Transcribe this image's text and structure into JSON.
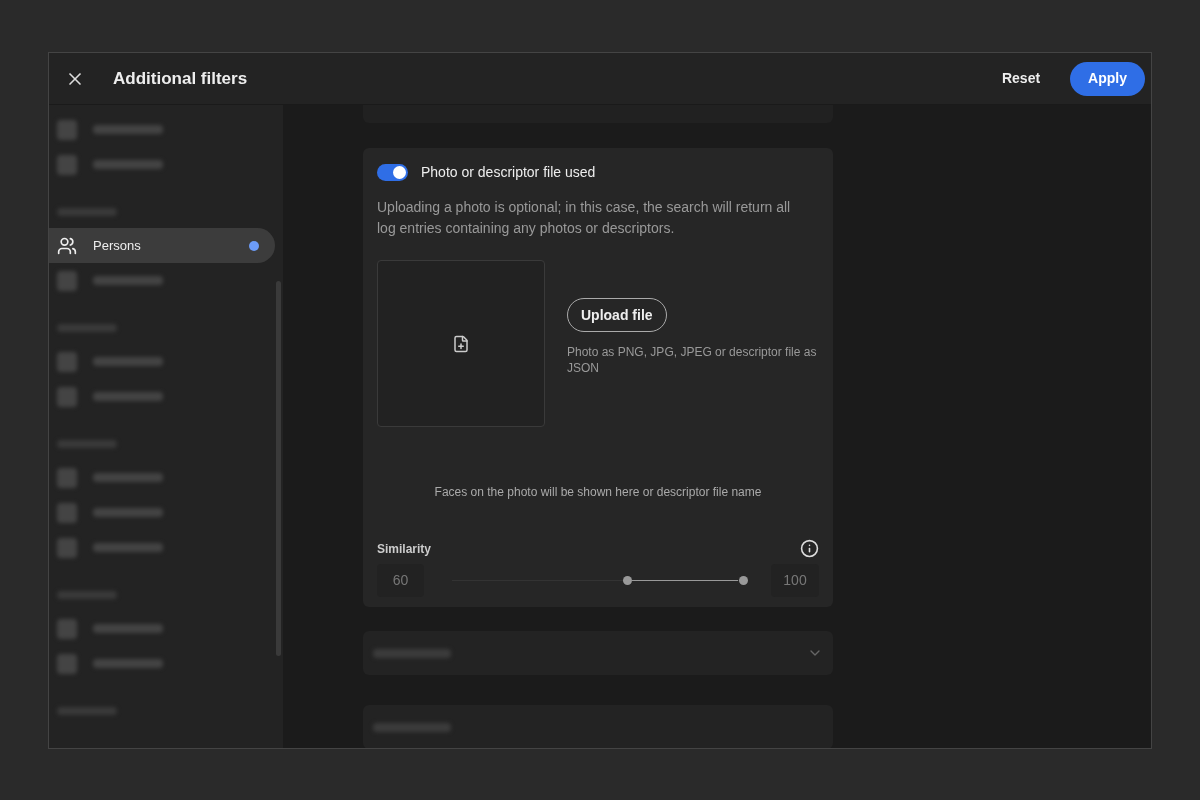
{
  "header": {
    "title": "Additional filters",
    "reset": "Reset",
    "apply": "Apply"
  },
  "sidebar": {
    "items": [
      {
        "kind": "blurred_item"
      },
      {
        "kind": "blurred_item"
      },
      {
        "kind": "blurred_heading"
      },
      {
        "kind": "item",
        "label": "Persons",
        "selected": true,
        "color": "#6c9cf8"
      },
      {
        "kind": "blurred_item"
      },
      {
        "kind": "blurred_heading"
      },
      {
        "kind": "blurred_item"
      },
      {
        "kind": "blurred_item"
      },
      {
        "kind": "blurred_heading"
      },
      {
        "kind": "blurred_item"
      },
      {
        "kind": "blurred_item"
      },
      {
        "kind": "blurred_item"
      },
      {
        "kind": "blurred_heading"
      },
      {
        "kind": "blurred_item"
      },
      {
        "kind": "blurred_item"
      },
      {
        "kind": "blurred_heading"
      }
    ]
  },
  "photo_card": {
    "toggle": {
      "label": "Photo or descriptor file used",
      "on": true
    },
    "description": "Uploading a photo is optional; in this case, the search will return all log entries containing any photos or descriptors.",
    "upload_button": "Upload file",
    "formats": "Photo as PNG, JPG, JPEG or descriptor file as JSON",
    "faces_hint": "Faces on the photo will be shown here or descriptor file name",
    "similarity": {
      "label": "Similarity",
      "min_value": "60",
      "max_value": "100",
      "thumbs": [
        {
          "level": 0.6
        },
        {
          "level": 1
        }
      ]
    }
  },
  "sections": [
    {
      "kind": "blurred",
      "expandable": true
    },
    {
      "kind": "blurred",
      "expandable": false
    }
  ]
}
